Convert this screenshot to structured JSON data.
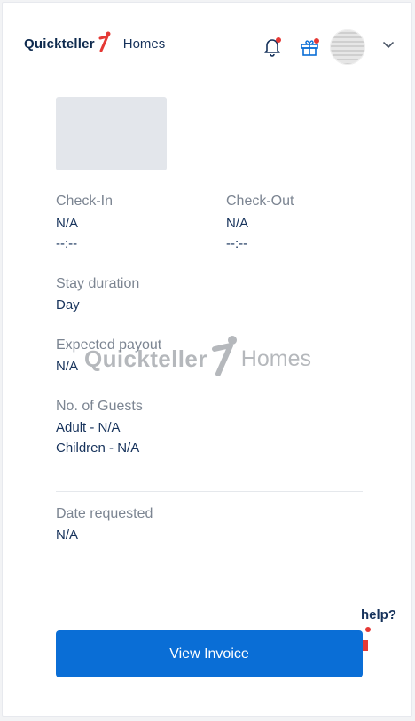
{
  "brand": {
    "name": "Quickteller",
    "sub": "Homes"
  },
  "header_icons": [
    "bell-icon",
    "gift-icon",
    "chevron-down-icon"
  ],
  "colors": {
    "primary": "#0a6ed6",
    "navy": "#16325b",
    "muted": "#7c8592",
    "accent_red": "#e53935"
  },
  "details": {
    "check_in": {
      "label": "Check-In",
      "date": "N/A",
      "time": "--:--"
    },
    "check_out": {
      "label": "Check-Out",
      "date": "N/A",
      "time": "--:--"
    },
    "stay_duration": {
      "label": "Stay duration",
      "value": "Day"
    },
    "expected_payout": {
      "label": "Expected payout",
      "value": "N/A"
    },
    "guests": {
      "label": "No. of Guests",
      "adult": "Adult - N/A",
      "children": "Children - N/A"
    },
    "date_requested": {
      "label": "Date requested",
      "value": "N/A"
    }
  },
  "help": {
    "text": "help?"
  },
  "actions": {
    "view_invoice": "View Invoice"
  },
  "watermark": {
    "name": "Quickteller",
    "sub": "Homes"
  }
}
